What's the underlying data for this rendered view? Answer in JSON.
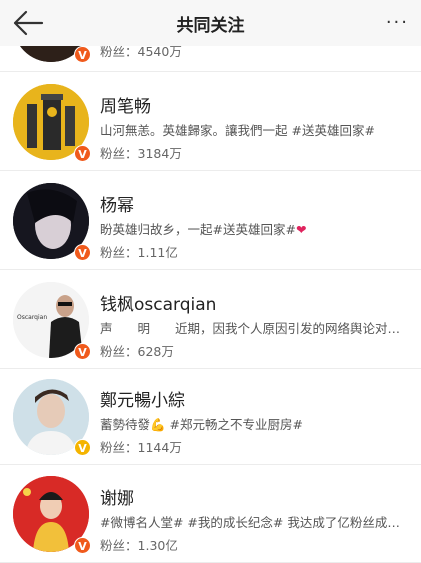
{
  "header": {
    "title": "共同关注",
    "more": "···"
  },
  "users": [
    {
      "name": "",
      "desc": "",
      "fans_label": "粉丝：",
      "fans": "4540万",
      "badge": "V"
    },
    {
      "name": "周笔畅",
      "desc": "山河無恙。英雄歸家。讓我們一起 #送英雄回家#",
      "fans_label": "粉丝：",
      "fans": "3184万",
      "badge": "V"
    },
    {
      "name": "杨幂",
      "desc": "盼英雄归故乡，一起#送英雄回家#",
      "heart": "❤",
      "fans_label": "粉丝：",
      "fans": "1.11亿",
      "badge": "V"
    },
    {
      "name": "钱枫oscarqian",
      "desc": "声　　明　　近期，因我个人原因引发的网络舆论对…",
      "avatar_text": "Oscarqian",
      "fans_label": "粉丝：",
      "fans": "628万",
      "badge": "V"
    },
    {
      "name": "鄭元暢小綜",
      "desc": "蓄勢待發💪 #郑元畅之不专业厨房#",
      "fans_label": "粉丝：",
      "fans": "1144万",
      "badge": "V"
    },
    {
      "name": "谢娜",
      "desc": "#微博名人堂# #我的成长纪念# 我达成了亿粉丝成…",
      "fans_label": "粉丝：",
      "fans": "1.30亿",
      "badge": "V"
    }
  ],
  "colors": {
    "verified_red": "#f05a1c",
    "verified_yellow": "#f4b400"
  }
}
